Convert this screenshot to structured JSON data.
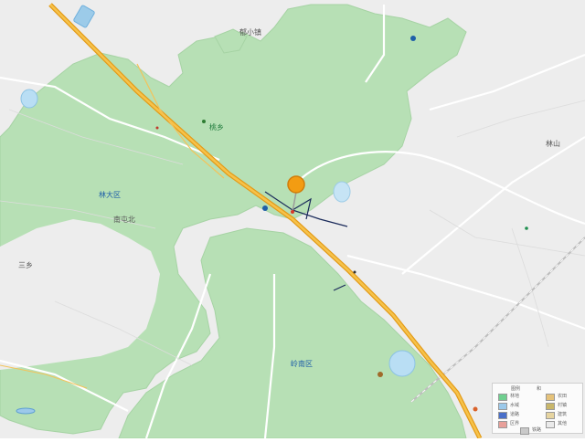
{
  "map": {
    "place_labels": [
      "郁小镇",
      "桃乡",
      "林大区",
      "南屯北",
      "林山",
      "岭南区",
      "三乡"
    ],
    "pin": {
      "color": "#f39c12",
      "type": "map-marker"
    }
  },
  "legend": {
    "title_left": "图例",
    "title_right": "和",
    "items": [
      {
        "label": "林地",
        "color": "#6fcf8f"
      },
      {
        "label": "水域",
        "color": "#9cc9ea"
      },
      {
        "label": "道路",
        "color": "#4a6fc9"
      },
      {
        "label": "区界",
        "color": "#e8a09a"
      },
      {
        "label": "农田",
        "color": "#e5c27a"
      },
      {
        "label": "村镇",
        "color": "#c8b66a"
      },
      {
        "label": "建筑",
        "color": "#e6d4a0"
      },
      {
        "label": "其他",
        "color": "#eaeaea"
      },
      {
        "label": "铁路",
        "color": "#c9c9c9"
      }
    ]
  },
  "colors": {
    "forest": "#b7e0b5",
    "forest_edge": "#a9d7a8",
    "land": "#ececec",
    "water": "#b9def4",
    "highway": "#f2b233",
    "highway_edge": "#e39a17",
    "road": "#ffffff",
    "pin": "#f39c12"
  }
}
